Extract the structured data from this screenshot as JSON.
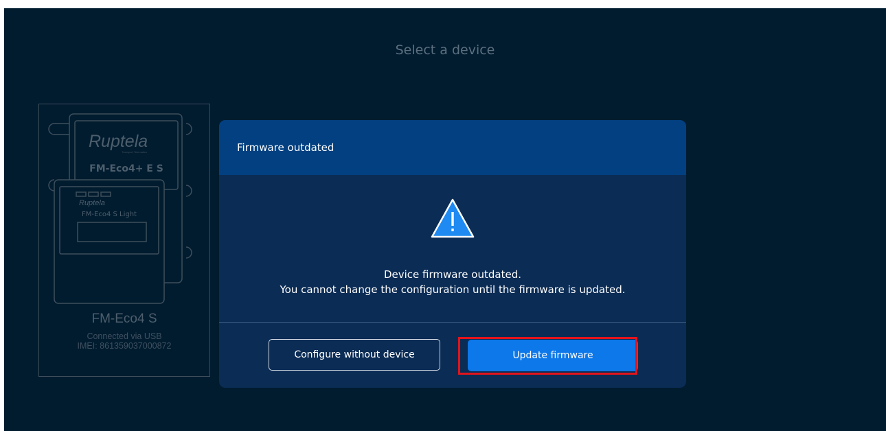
{
  "page": {
    "title": "Select a device"
  },
  "device_card": {
    "logo_front": "Ruptela",
    "logo_back_tagline": "Transport Telematics",
    "back_model_label": "FM-Eco4+ E S",
    "front_model_label": "FM-Eco4 S Light",
    "model": "FM-Eco4 S",
    "connection": "Connected via USB",
    "imei": "IMEI: 861359037000872"
  },
  "dialog": {
    "title": "Firmware outdated",
    "message_line1": "Device firmware outdated.",
    "message_line2": "You cannot change the configuration until the firmware is updated.",
    "secondary_button": "Configure without device",
    "primary_button": "Update firmware"
  },
  "colors": {
    "background": "#011c2f",
    "dialog_body": "#0b2c55",
    "dialog_header": "#024081",
    "primary_button": "#0d78ea",
    "warning_icon": "#1e8af2",
    "highlight_box": "#e3141c"
  },
  "icons": {
    "warning": "warning-triangle-icon"
  }
}
